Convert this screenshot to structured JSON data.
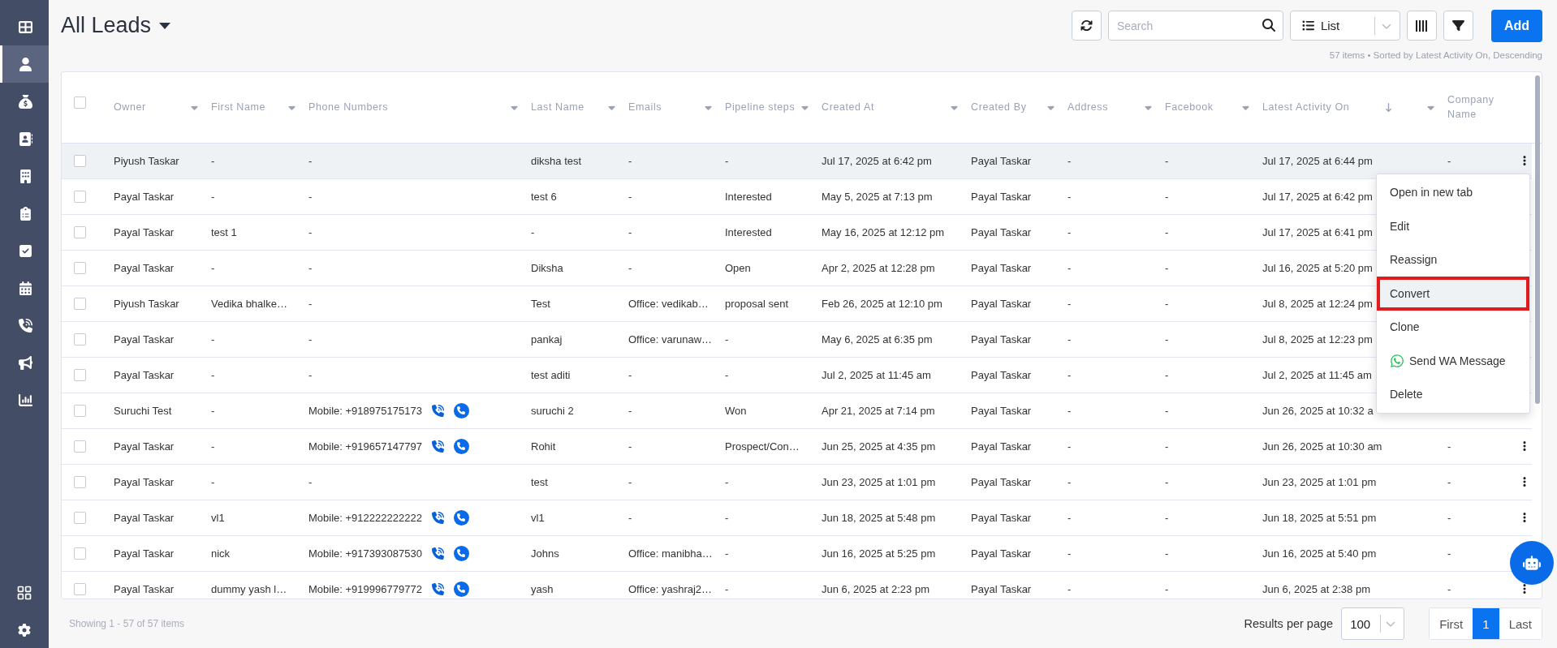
{
  "sidebar": {
    "items": [
      {
        "selected": false
      },
      {
        "selected": true
      },
      {
        "selected": false
      },
      {
        "selected": false
      },
      {
        "selected": false
      },
      {
        "selected": false
      },
      {
        "selected": false
      },
      {
        "selected": false
      },
      {
        "selected": false
      },
      {
        "selected": false
      },
      {
        "selected": false
      }
    ]
  },
  "header": {
    "title": "All Leads",
    "search": {
      "placeholder": "Search"
    },
    "view": "List",
    "add": "Add",
    "summary": "57 items • Sorted by Latest Activity On, Descending"
  },
  "table": {
    "select_all": {
      "checked": false
    },
    "columns": [
      {
        "label": "Owner",
        "caret": true,
        "sorted": false
      },
      {
        "label": "First Name",
        "caret": true,
        "sorted": false
      },
      {
        "label": "Phone Numbers",
        "caret": true,
        "sorted": false
      },
      {
        "label": "Last Name",
        "caret": true,
        "sorted": false
      },
      {
        "label": "Emails",
        "caret": true,
        "sorted": false
      },
      {
        "label": "Pipeline steps",
        "caret": true,
        "sorted": false
      },
      {
        "label": "Created At",
        "caret": true,
        "sorted": false
      },
      {
        "label": "Created By",
        "caret": true,
        "sorted": false
      },
      {
        "label": "Address",
        "caret": true,
        "sorted": false
      },
      {
        "label": "Facebook",
        "caret": true,
        "sorted": false
      },
      {
        "label": "Latest Activity On",
        "caret": true,
        "sorted": true
      },
      {
        "label": "Company Name",
        "caret": false,
        "sorted": false
      }
    ],
    "rows": [
      {
        "selected": true,
        "checked": false,
        "cells": [
          "Piyush Taskar",
          "-",
          "-",
          "diksha test",
          "-",
          "-",
          "Jul 17, 2025 at 6:42 pm",
          "Payal Taskar",
          "-",
          "-",
          "Jul 17, 2025 at 6:44 pm",
          "-"
        ],
        "dial": false,
        "actions": true
      },
      {
        "selected": false,
        "checked": false,
        "cells": [
          "Payal Taskar",
          "-",
          "-",
          "test 6",
          "-",
          "Interested",
          "May 5, 2025 at 7:13 pm",
          "Payal Taskar",
          "-",
          "-",
          "Jul 17, 2025 at 6:42 pm"
        ],
        "dial": false,
        "actions": false
      },
      {
        "selected": false,
        "checked": false,
        "cells": [
          "Payal Taskar",
          "test 1",
          "-",
          "-",
          "-",
          "Interested",
          "May 16, 2025 at 12:12 pm",
          "Payal Taskar",
          "-",
          "-",
          "Jul 17, 2025 at 6:41 pm"
        ],
        "dial": false,
        "actions": false
      },
      {
        "selected": false,
        "checked": false,
        "cells": [
          "Payal Taskar",
          "-",
          "-",
          "Diksha",
          "-",
          "Open",
          "Apr 2, 2025 at 12:28 pm",
          "Payal Taskar",
          "-",
          "-",
          "Jul 16, 2025 at 5:20 pm"
        ],
        "dial": false,
        "actions": false
      },
      {
        "selected": false,
        "checked": false,
        "cells": [
          "Piyush Taskar",
          "Vedika bhalke…",
          "-",
          "Test",
          "Office: vedikab…",
          "proposal sent",
          "Feb 26, 2025 at 12:10 pm",
          "Payal Taskar",
          "-",
          "-",
          "Jul 8, 2025 at 12:24 pm"
        ],
        "dial": false,
        "actions": false
      },
      {
        "selected": false,
        "checked": false,
        "cells": [
          "Payal Taskar",
          "-",
          "-",
          "pankaj",
          "Office: varunaw…",
          "-",
          "May 6, 2025 at 6:35 pm",
          "Payal Taskar",
          "-",
          "-",
          "Jul 8, 2025 at 12:23 pm"
        ],
        "dial": false,
        "actions": false
      },
      {
        "selected": false,
        "checked": false,
        "cells": [
          "Payal Taskar",
          "-",
          "-",
          "test aditi",
          "-",
          "-",
          "Jul 2, 2025 at 11:45 am",
          "Payal Taskar",
          "-",
          "-",
          "Jul 2, 2025 at 11:45 am"
        ],
        "dial": false,
        "actions": false
      },
      {
        "selected": false,
        "checked": false,
        "cells": [
          "Suruchi Test",
          "-",
          "Mobile: +918975175173",
          "suruchi 2",
          "-",
          "Won",
          "Apr 21, 2025 at 7:14 pm",
          "Payal Taskar",
          "-",
          "-",
          "Jun 26, 2025 at 10:32 a"
        ],
        "dial": true,
        "actions": false
      },
      {
        "selected": false,
        "checked": false,
        "cells": [
          "Payal Taskar",
          "-",
          "Mobile: +919657147797",
          "Rohit",
          "-",
          "Prospect/Con…",
          "Jun 25, 2025 at 4:35 pm",
          "Payal Taskar",
          "-",
          "-",
          "Jun 26, 2025 at 10:30 am",
          "-"
        ],
        "dial": true,
        "actions": true
      },
      {
        "selected": false,
        "checked": false,
        "cells": [
          "Payal Taskar",
          "-",
          "-",
          "test",
          "-",
          "-",
          "Jun 23, 2025 at 1:01 pm",
          "Payal Taskar",
          "-",
          "-",
          "Jun 23, 2025 at 1:01 pm",
          "-"
        ],
        "dial": false,
        "actions": true
      },
      {
        "selected": false,
        "checked": false,
        "cells": [
          "Payal Taskar",
          "vl1",
          "Mobile: +912222222222",
          "vl1",
          "-",
          "-",
          "Jun 18, 2025 at 5:48 pm",
          "Payal Taskar",
          "-",
          "-",
          "Jun 18, 2025 at 5:51 pm",
          "-"
        ],
        "dial": true,
        "actions": true
      },
      {
        "selected": false,
        "checked": false,
        "cells": [
          "Payal Taskar",
          "nick",
          "Mobile: +917393087530",
          "Johns",
          "Office: manibha…",
          "-",
          "Jun 16, 2025 at 5:25 pm",
          "Payal Taskar",
          "-",
          "-",
          "Jun 16, 2025 at 5:40 pm",
          "-"
        ],
        "dial": true,
        "actions": false
      },
      {
        "selected": false,
        "checked": false,
        "cells": [
          "Payal Taskar",
          "dummy yash l…",
          "Mobile: +919996779772",
          "yash",
          "Office: yashraj2…",
          "-",
          "Jun 6, 2025 at 2:23 pm",
          "Payal Taskar",
          "-",
          "-",
          "Jun 6, 2025 at 2:38 pm",
          "-"
        ],
        "dial": true,
        "actions": true
      }
    ]
  },
  "row_menu": {
    "items": [
      {
        "label": "Open in new tab",
        "kind": "plain",
        "selected": false
      },
      {
        "label": "Edit",
        "kind": "plain",
        "selected": false
      },
      {
        "label": "Reassign",
        "kind": "plain",
        "selected": false
      },
      {
        "label": "Convert",
        "kind": "plain",
        "selected": true
      },
      {
        "label": "Clone",
        "kind": "plain",
        "selected": false
      },
      {
        "label": "Send WA Message",
        "kind": "whatsapp",
        "selected": false
      },
      {
        "label": "Delete",
        "kind": "plain",
        "selected": false
      }
    ]
  },
  "footer": {
    "showing": "Showing 1 - 57 of 57 items",
    "per_page_label": "Results per page",
    "per_page": "100",
    "pages": [
      {
        "label": "First",
        "selected": false
      },
      {
        "label": "1",
        "selected": true
      },
      {
        "label": "Last",
        "selected": false
      }
    ]
  }
}
